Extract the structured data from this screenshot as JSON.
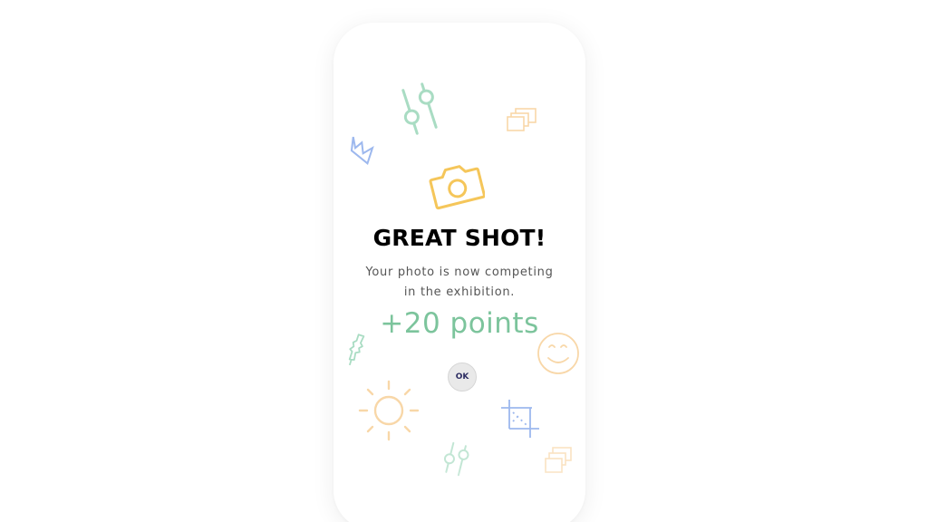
{
  "dialog": {
    "title": "GREAT SHOT!",
    "message_line1": "Your photo is now competing",
    "message_line2": "in the exhibition.",
    "points": "+20 points",
    "ok_label": "OK"
  },
  "icons": {
    "main": "camera-icon",
    "decorations": [
      "sliders-icon",
      "layers-icon",
      "crown-icon",
      "brush-icon",
      "smiley-icon",
      "sun-icon",
      "crop-icon",
      "sliders-icon",
      "layers-icon"
    ]
  },
  "colors": {
    "accent_green": "#7cc49c",
    "camera_yellow": "#f5c65a",
    "decor_mint": "#a9dcc3",
    "decor_blue": "#9db8ee",
    "decor_peach": "#f8d7a8",
    "ok_text": "#2d2d62"
  }
}
